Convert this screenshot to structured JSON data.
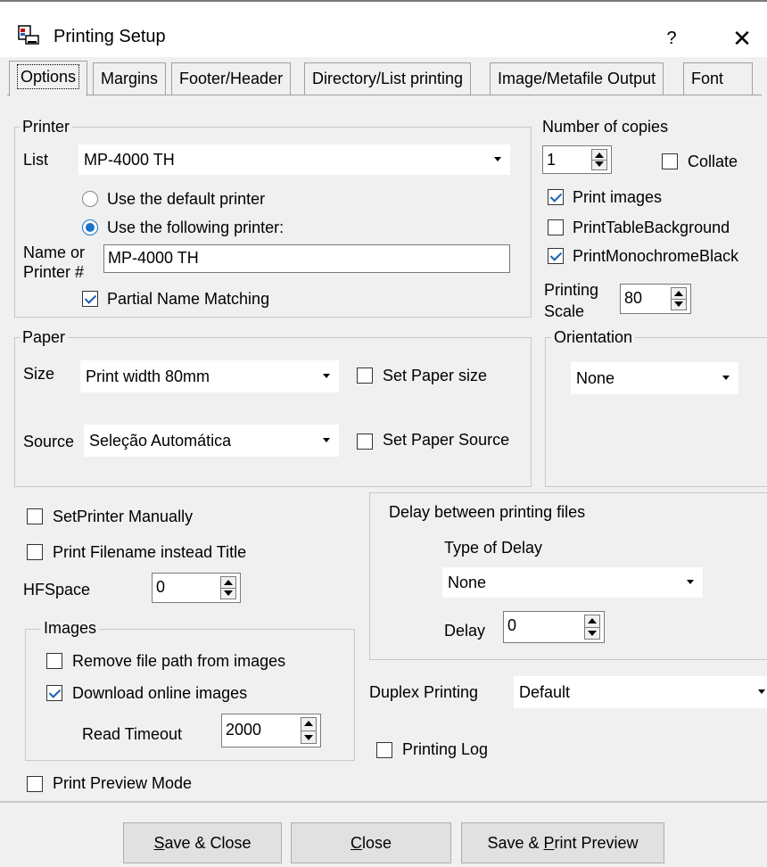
{
  "window": {
    "title": "Printing Setup",
    "help": "?",
    "close": "✕"
  },
  "tabs": [
    {
      "label": "Options"
    },
    {
      "label": "Margins"
    },
    {
      "label": "Footer/Header"
    },
    {
      "label": "Directory/List printing"
    },
    {
      "label": "Image/Metafile Output"
    },
    {
      "label": "Font"
    }
  ],
  "printer": {
    "group_title": "Printer",
    "list_label": "List",
    "list_value": "MP-4000 TH",
    "radio_default": "Use the default printer",
    "radio_following": "Use the following printer:",
    "name_label_1": "Name or",
    "name_label_2": "Printer #",
    "name_value": "MP-4000 TH",
    "partial_label": "Partial Name Matching"
  },
  "copies": {
    "title": "Number of copies",
    "value": "1",
    "collate_label": "Collate",
    "print_images": "Print images",
    "print_table_bg": "PrintTableBackground",
    "print_mono": "PrintMonochromeBlack",
    "scale_label_1": "Printing",
    "scale_label_2": "Scale",
    "scale_value": "80"
  },
  "paper": {
    "group_title": "Paper",
    "size_label": "Size",
    "size_value": "Print width 80mm",
    "set_size_label": "Set Paper size",
    "source_label": "Source",
    "source_value": "Seleção Automática",
    "set_source_label": "Set Paper Source"
  },
  "orientation": {
    "title": "Orientation",
    "value": "None"
  },
  "misc": {
    "set_printer_manually": "SetPrinter Manually",
    "print_filename": "Print Filename instead Title",
    "hfspace_label": "HFSpace",
    "hfspace_value": "0",
    "print_preview_mode": "Print Preview Mode"
  },
  "images": {
    "group_title": "Images",
    "remove_path": "Remove file path from images",
    "download_online": "Download online images",
    "timeout_label": "Read Timeout",
    "timeout_value": "2000"
  },
  "delay": {
    "group_title": "Delay between printing files",
    "type_label": "Type of Delay",
    "type_value": "None",
    "delay_label": "Delay",
    "delay_value": "0"
  },
  "duplex": {
    "label": "Duplex Printing",
    "value": "Default"
  },
  "printing_log": "Printing Log",
  "buttons": {
    "save_close_u": "S",
    "save_close_rest": "ave & Close",
    "close_u": "C",
    "close_rest": "lose",
    "preview_pre": "Save & ",
    "preview_u": "P",
    "preview_rest": "rint Preview"
  }
}
